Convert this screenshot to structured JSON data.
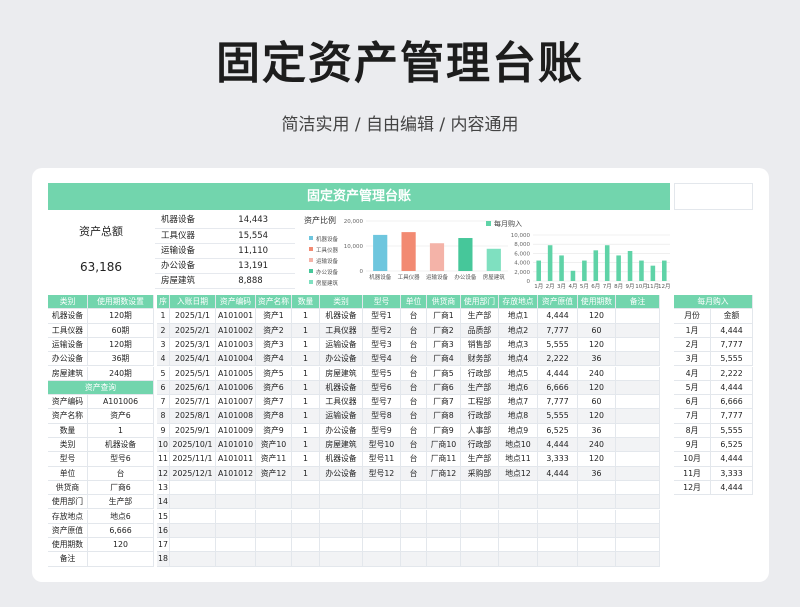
{
  "page": {
    "title": "固定资产管理台账",
    "subtitle": "简洁实用 / 自由编辑 / 内容通用"
  },
  "sheet": {
    "banner": "固定资产管理台账",
    "total_label": "资产总额",
    "total_value": "63,186",
    "summary": [
      {
        "name": "机器设备",
        "value": "14,443"
      },
      {
        "name": "工具仪器",
        "value": "15,554"
      },
      {
        "name": "运输设备",
        "value": "11,110"
      },
      {
        "name": "办公设备",
        "value": "13,191"
      },
      {
        "name": "房屋建筑",
        "value": "8,888"
      }
    ],
    "category_header": [
      "类别",
      "使用期数设置"
    ],
    "categories": [
      {
        "name": "机器设备",
        "period": "120期"
      },
      {
        "name": "工具仪器",
        "period": "60期"
      },
      {
        "name": "运输设备",
        "period": "120期"
      },
      {
        "name": "办公设备",
        "period": "36期"
      },
      {
        "name": "房屋建筑",
        "period": "240期"
      }
    ],
    "query_header": "资产查询",
    "query": [
      {
        "label": "资产编码",
        "value": "A101006"
      },
      {
        "label": "资产名称",
        "value": "资产6"
      },
      {
        "label": "数量",
        "value": "1"
      },
      {
        "label": "类别",
        "value": "机器设备"
      },
      {
        "label": "型号",
        "value": "型号6"
      },
      {
        "label": "单位",
        "value": "台"
      },
      {
        "label": "供货商",
        "value": "厂商6"
      },
      {
        "label": "使用部门",
        "value": "生产部"
      },
      {
        "label": "存放地点",
        "value": "地点6"
      },
      {
        "label": "资产原值",
        "value": "6,666"
      },
      {
        "label": "使用期数",
        "value": "120"
      },
      {
        "label": "备注",
        "value": ""
      }
    ],
    "table_headers": [
      "序",
      "入账日期",
      "资产编码",
      "资产名称",
      "数量",
      "类别",
      "型号",
      "单位",
      "供货商",
      "使用部门",
      "存放地点",
      "资产原值",
      "使用期数",
      "备注"
    ],
    "rows": [
      [
        "1",
        "2025/1/1",
        "A101001",
        "资产1",
        "1",
        "机器设备",
        "型号1",
        "台",
        "厂商1",
        "生产部",
        "地点1",
        "4,444",
        "120",
        ""
      ],
      [
        "2",
        "2025/2/1",
        "A101002",
        "资产2",
        "1",
        "工具仪器",
        "型号2",
        "台",
        "厂商2",
        "品质部",
        "地点2",
        "7,777",
        "60",
        ""
      ],
      [
        "3",
        "2025/3/1",
        "A101003",
        "资产3",
        "1",
        "运输设备",
        "型号3",
        "台",
        "厂商3",
        "销售部",
        "地点3",
        "5,555",
        "120",
        ""
      ],
      [
        "4",
        "2025/4/1",
        "A101004",
        "资产4",
        "1",
        "办公设备",
        "型号4",
        "台",
        "厂商4",
        "财务部",
        "地点4",
        "2,222",
        "36",
        ""
      ],
      [
        "5",
        "2025/5/1",
        "A101005",
        "资产5",
        "1",
        "房屋建筑",
        "型号5",
        "台",
        "厂商5",
        "行政部",
        "地点5",
        "4,444",
        "240",
        ""
      ],
      [
        "6",
        "2025/6/1",
        "A101006",
        "资产6",
        "1",
        "机器设备",
        "型号6",
        "台",
        "厂商6",
        "生产部",
        "地点6",
        "6,666",
        "120",
        ""
      ],
      [
        "7",
        "2025/7/1",
        "A101007",
        "资产7",
        "1",
        "工具仪器",
        "型号7",
        "台",
        "厂商7",
        "工程部",
        "地点7",
        "7,777",
        "60",
        ""
      ],
      [
        "8",
        "2025/8/1",
        "A101008",
        "资产8",
        "1",
        "运输设备",
        "型号8",
        "台",
        "厂商8",
        "行政部",
        "地点8",
        "5,555",
        "120",
        ""
      ],
      [
        "9",
        "2025/9/1",
        "A101009",
        "资产9",
        "1",
        "办公设备",
        "型号9",
        "台",
        "厂商9",
        "人事部",
        "地点9",
        "6,525",
        "36",
        ""
      ],
      [
        "10",
        "2025/10/1",
        "A101010",
        "资产10",
        "1",
        "房屋建筑",
        "型号10",
        "台",
        "厂商10",
        "行政部",
        "地点10",
        "4,444",
        "240",
        ""
      ],
      [
        "11",
        "2025/11/1",
        "A101011",
        "资产11",
        "1",
        "机器设备",
        "型号11",
        "台",
        "厂商11",
        "生产部",
        "地点11",
        "3,333",
        "120",
        ""
      ],
      [
        "12",
        "2025/12/1",
        "A101012",
        "资产12",
        "1",
        "办公设备",
        "型号12",
        "台",
        "厂商12",
        "采购部",
        "地点12",
        "4,444",
        "36",
        ""
      ],
      [
        "13",
        "",
        "",
        "",
        "",
        "",
        "",
        "",
        "",
        "",
        "",
        "",
        "",
        ""
      ],
      [
        "14",
        "",
        "",
        "",
        "",
        "",
        "",
        "",
        "",
        "",
        "",
        "",
        "",
        ""
      ],
      [
        "15",
        "",
        "",
        "",
        "",
        "",
        "",
        "",
        "",
        "",
        "",
        "",
        "",
        ""
      ],
      [
        "16",
        "",
        "",
        "",
        "",
        "",
        "",
        "",
        "",
        "",
        "",
        "",
        "",
        ""
      ],
      [
        "17",
        "",
        "",
        "",
        "",
        "",
        "",
        "",
        "",
        "",
        "",
        "",
        "",
        ""
      ],
      [
        "18",
        "",
        "",
        "",
        "",
        "",
        "",
        "",
        "",
        "",
        "",
        "",
        "",
        ""
      ]
    ],
    "monthly_header": "每月购入",
    "monthly_cols": [
      "月份",
      "金额"
    ],
    "monthly": [
      {
        "month": "1月",
        "amount": "4,444"
      },
      {
        "month": "2月",
        "amount": "7,777"
      },
      {
        "month": "3月",
        "amount": "5,555"
      },
      {
        "month": "4月",
        "amount": "2,222"
      },
      {
        "month": "5月",
        "amount": "4,444"
      },
      {
        "month": "6月",
        "amount": "6,666"
      },
      {
        "month": "7月",
        "amount": "7,777"
      },
      {
        "month": "8月",
        "amount": "5,555"
      },
      {
        "month": "9月",
        "amount": "6,525"
      },
      {
        "month": "10月",
        "amount": "4,444"
      },
      {
        "month": "11月",
        "amount": "3,333"
      },
      {
        "month": "12月",
        "amount": "4,444"
      }
    ]
  },
  "colors": {
    "accent": "#72d5ad",
    "bar_colors": [
      "#6ec6de",
      "#f28a72",
      "#f4b3a8",
      "#46c79a",
      "#7fe0c0"
    ],
    "monthly_bar": "#5fd3a7"
  },
  "chart_data": [
    {
      "type": "bar",
      "title": "资产比例",
      "categories": [
        "机器设备",
        "工具仪器",
        "运输设备",
        "办公设备",
        "房屋建筑"
      ],
      "values": [
        14443,
        15554,
        11110,
        13191,
        8888
      ],
      "ylim": [
        0,
        20000
      ],
      "yticks": [
        "0",
        "10,000",
        "20,000"
      ],
      "legend": [
        "机器设备",
        "工具仪器",
        "运输设备",
        "办公设备",
        "房屋建筑"
      ],
      "legend_position": "left",
      "grid": true
    },
    {
      "type": "bar",
      "legend": [
        "每月购入"
      ],
      "categories": [
        "1月",
        "2月",
        "3月",
        "4月",
        "5月",
        "6月",
        "7月",
        "8月",
        "9月",
        "10月",
        "11月",
        "12月"
      ],
      "series": [
        {
          "name": "每月购入",
          "values": [
            4444,
            7777,
            5555,
            2222,
            4444,
            6666,
            7777,
            5555,
            6525,
            4444,
            3333,
            4444
          ]
        }
      ],
      "ylim": [
        0,
        10000
      ],
      "yticks": [
        "0",
        "2,000",
        "4,000",
        "6,000",
        "8,000",
        "10,000"
      ],
      "legend_position": "top-left",
      "grid": true
    }
  ]
}
